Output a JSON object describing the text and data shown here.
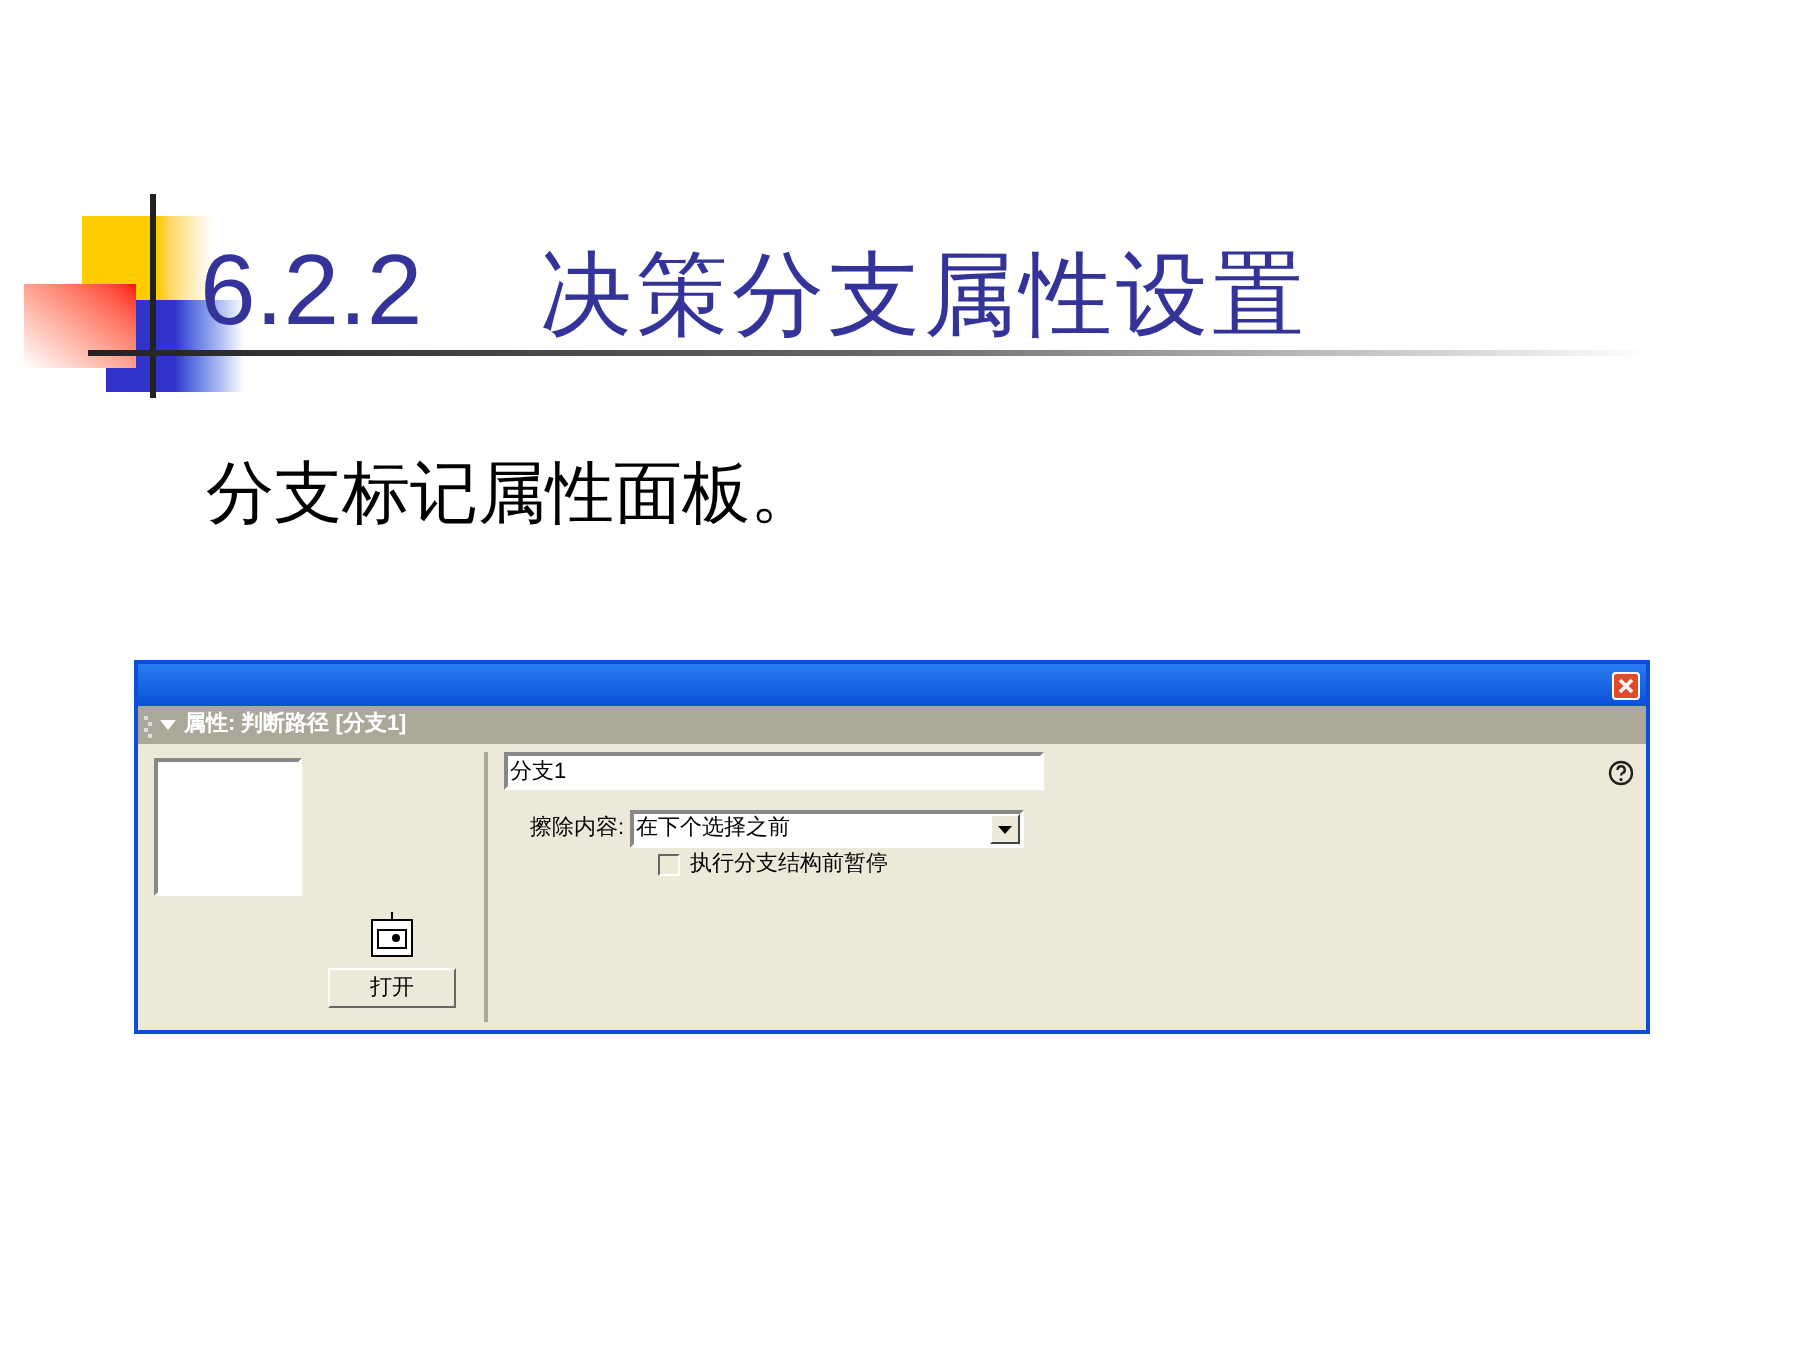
{
  "slide": {
    "section_number": "6.2.2",
    "title": "决策分支属性设置",
    "subtitle": "分支标记属性面板。"
  },
  "panel": {
    "header": "属性: 判断路径 [分支1]",
    "name_field": {
      "value": "分支1"
    },
    "erase": {
      "label": "擦除内容:",
      "value": "在下个选择之前"
    },
    "pause_checkbox": {
      "label": "执行分支结构前暂停",
      "checked": false
    },
    "open_button": "打开"
  }
}
